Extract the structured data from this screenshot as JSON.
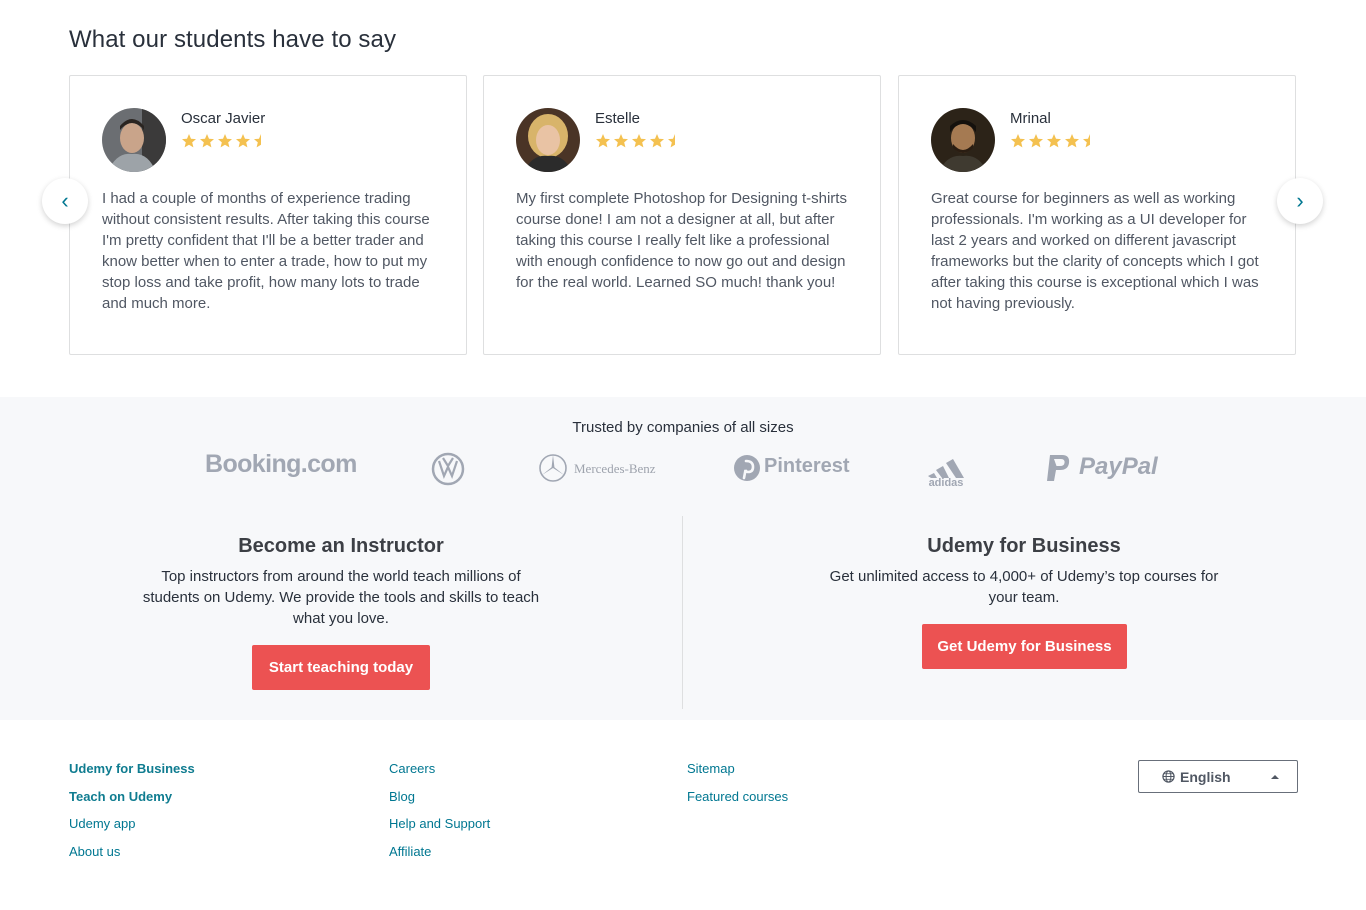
{
  "testimonials": {
    "title": "What our students have to say",
    "prev_icon": "chevron-left-icon",
    "next_icon": "chevron-right-icon",
    "prev_glyph": "‹",
    "next_glyph": "›",
    "rating_color": "#f4c150",
    "items": [
      {
        "name": "Oscar Javier",
        "rating": 4.5,
        "quote": "I had a couple of months of experience trading without consistent results. After taking this course I'm pretty confident that I'll be a better trader and know better when to enter a trade, how to put my stop loss and take profit, how many lots to trade and much more."
      },
      {
        "name": "Estelle",
        "rating": 4.5,
        "quote": "My first complete Photoshop for Designing t-shirts course done! I am not a designer at all, but after taking this course I really felt like a professional with enough confidence to now go out and design for the real world. Learned SO much! thank you!"
      },
      {
        "name": "Mrinal",
        "rating": 4.5,
        "quote": "Great course for beginners as well as working professionals. I'm working as a UI developer for last 2 years and worked on different javascript frameworks but the clarity of concepts which I got after taking this course is exceptional which I was not having previously."
      }
    ]
  },
  "trusted": {
    "label": "Trusted by companies of all sizes",
    "logos": {
      "booking": "Booking.com",
      "mercedes": "Mercedes-Benz",
      "pinterest": "Pinterest",
      "adidas": "adidas",
      "paypal": "PayPal"
    }
  },
  "instructor": {
    "title": "Become an Instructor",
    "text": "Top instructors from around the world teach millions of students on Udemy. We provide the tools and skills to teach what you love.",
    "cta": "Start teaching today"
  },
  "business": {
    "title": "Udemy for Business",
    "text": "Get unlimited access to 4,000+ of Udemy’s top courses for your team.",
    "cta": "Get Udemy for Business"
  },
  "colors": {
    "accent": "#ec5252",
    "link": "#007791",
    "band": "#f7f8fa"
  },
  "footer": {
    "col1": [
      "Udemy for Business",
      "Teach on Udemy",
      "Udemy app",
      "About us"
    ],
    "col2": [
      "Careers",
      "Blog",
      "Help and Support",
      "Affiliate"
    ],
    "col3": [
      "Sitemap",
      "Featured courses"
    ],
    "language": "English",
    "language_icon": "globe-icon"
  }
}
